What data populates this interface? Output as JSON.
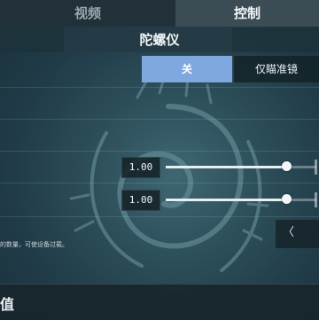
{
  "tabs": [
    {
      "label": "视频",
      "active": false
    },
    {
      "label": "控制",
      "active": true
    }
  ],
  "section": {
    "title": "陀螺仪"
  },
  "gyro": {
    "options": [
      "关",
      "仅瞄准镜"
    ],
    "selected": "关"
  },
  "sliders": [
    {
      "value_text": "1.00",
      "level": 0.8
    },
    {
      "value_text": "1.00",
      "level": 0.8
    }
  ],
  "arrow": {
    "glyph": "〈"
  },
  "hint_text": "的数量，可使设备过载。",
  "bottom": {
    "title": "值"
  },
  "colors": {
    "accent": "#7fa7e0",
    "background": "#2c4e59",
    "tabbar": "#27373f"
  }
}
